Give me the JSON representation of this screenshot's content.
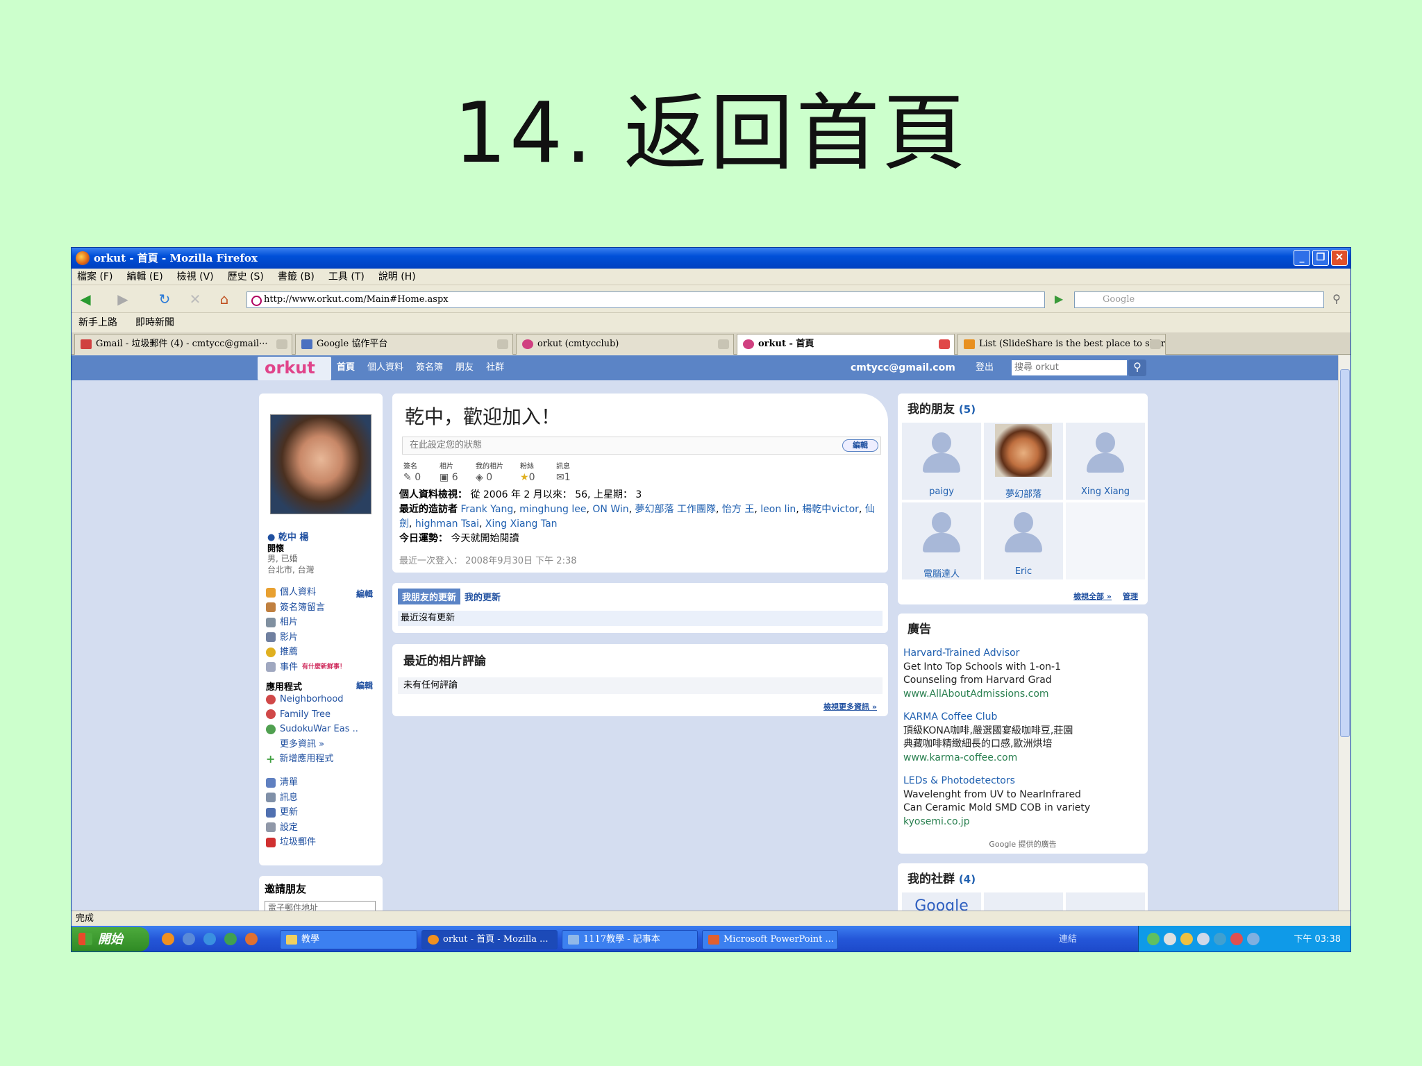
{
  "slide": {
    "title": "14. 返回首頁"
  },
  "window": {
    "title": "orkut - 首頁 - Mozilla Firefox"
  },
  "menubar": [
    "檔案 (F)",
    "編輯 (E)",
    "檢視 (V)",
    "歷史 (S)",
    "書籤 (B)",
    "工具 (T)",
    "說明 (H)"
  ],
  "toolbar": {
    "url": "http://www.orkut.com/Main#Home.aspx",
    "search_placeholder": "Google"
  },
  "bookmarks": [
    "新手上路",
    "即時新聞"
  ],
  "tabs": [
    {
      "label": "Gmail - 垃圾郵件 (4) - cmtycc@gmail···"
    },
    {
      "label": "Google 協作平台"
    },
    {
      "label": "orkut (cmtycclub)"
    },
    {
      "label": "orkut - 首頁"
    },
    {
      "label": "List (SlideShare is the best place to shar···"
    }
  ],
  "orkut": {
    "logo": "orkut",
    "nav": [
      "首頁",
      "個人資料",
      "簽名簿",
      "朋友",
      "社群"
    ],
    "user_email": "cmtycc@gmail.com",
    "logout": "登出",
    "search_placeholder": "搜尋 orkut"
  },
  "profile": {
    "name": "乾中 楊",
    "status": "開懷",
    "info1": "男, 已婚",
    "info2": "台北市, 台灣",
    "edit_label": "編輯",
    "menu": [
      "個人資料",
      "簽名簿留言",
      "相片",
      "影片",
      "推薦",
      "事件"
    ],
    "events_new": "有什麼新鮮事！",
    "apps_title": "應用程式",
    "apps_edit": "編輯",
    "apps": [
      "Neighborhood",
      "Family Tree",
      "SudokuWar Eas ..",
      "更多資訊 »"
    ],
    "add_app": "新增應用程式",
    "menu2": [
      "清單",
      "訊息",
      "更新",
      "設定",
      "垃圾郵件"
    ],
    "invite_title": "邀請朋友",
    "invite_placeholder": "電子郵件地址"
  },
  "main": {
    "welcome": "乾中，歡迎加入！",
    "status_placeholder": "在此設定您的狀態",
    "status_button": "編輯",
    "stats": [
      {
        "label": "簽名",
        "value": "0"
      },
      {
        "label": "相片",
        "value": "6"
      },
      {
        "label": "我的相片",
        "value": "0"
      },
      {
        "label": "粉絲",
        "value": "0"
      },
      {
        "label": "訊息",
        "value": "1"
      }
    ],
    "views_label": "個人資料檢視：",
    "views_text": "從 2006 年 2 月以來： 56, 上星期： 3",
    "visitors_label": "最近的造訪者",
    "visitors": [
      "Frank Yang",
      "minghung lee",
      "ON Win",
      "夢幻部落 工作團隊",
      "怡方 王",
      "leon lin",
      "楊乾中victor",
      "仙 劍",
      "highman Tsai",
      "Xing Xiang Tan"
    ],
    "fortune_label": "今日運勢：",
    "fortune_text": "今天就開始閱讀",
    "last_login": "最近一次登入： 2008年9月30日 下午 2:38",
    "update_tabs": [
      "我朋友的更新",
      "我的更新"
    ],
    "no_updates": "最近沒有更新",
    "photo_comments_title": "最近的相片評論",
    "no_comments": "未有任何評論",
    "more_photos": "檢視更多資訊 »"
  },
  "friends": {
    "title": "我的朋友",
    "count": "(5)",
    "list": [
      "paigy",
      "夢幻部落",
      "Xing Xiang",
      "電腦達人",
      "Eric"
    ],
    "view_all": "檢視全部 »",
    "manage": "管理"
  },
  "ads": {
    "title": "廣告",
    "items": [
      {
        "title": "Harvard-Trained Advisor",
        "line1": "Get Into Top Schools with 1-on-1",
        "line2": "Counseling from Harvard Grad",
        "url": "www.AllAboutAdmissions.com"
      },
      {
        "title": "KARMA Coffee Club",
        "line1": "頂級KONA咖啡,嚴選國宴級咖啡豆,莊園",
        "line2": "典藏咖啡精緻細長的口感,歐洲烘培",
        "url": "www.karma-coffee.com"
      },
      {
        "title": "LEDs & Photodetectors",
        "line1": "Wavelenght from UV to NearInfrared",
        "line2": "Can Ceramic Mold SMD COB in variety",
        "url": "kyosemi.co.jp"
      }
    ],
    "footer": "Google 提供的廣告"
  },
  "communities": {
    "title": "我的社群",
    "count": "(4)",
    "first": "Google"
  },
  "statusbar": {
    "text": "完成"
  },
  "taskbar": {
    "start": "開始",
    "buttons": [
      "教學",
      "orkut - 首頁 - Mozilla ...",
      "1117教學 - 記事本",
      "Microsoft PowerPoint ..."
    ],
    "links": "連結",
    "clock": "下午 03:38"
  }
}
